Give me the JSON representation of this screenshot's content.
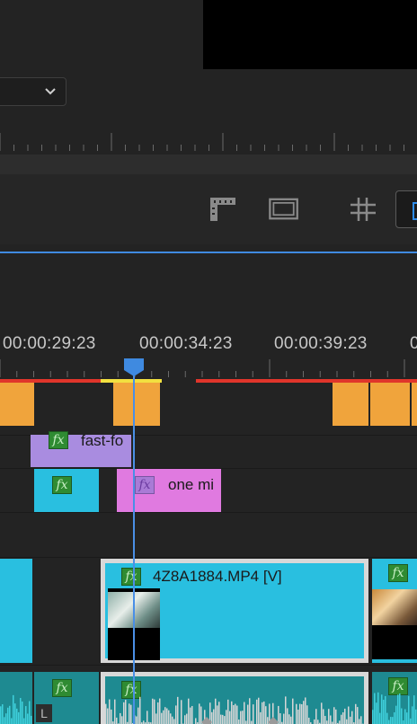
{
  "timeline": {
    "timecodes": [
      "00:00:29:23",
      "00:00:34:23",
      "00:00:39:23",
      "0"
    ]
  },
  "clips": {
    "graphic_upper": {
      "name": "fast-fo",
      "fx": "fx"
    },
    "graphic_lower_teal": {
      "fx": "fx"
    },
    "graphic_pink": {
      "name": "one mi",
      "fx": "fx"
    },
    "video_main": {
      "name": "4Z8A1884.MP4 [V]",
      "fx": "fx"
    },
    "video_right": {
      "fx": "fx"
    },
    "audio_left_small": {
      "fx": "fx",
      "channel": "L"
    },
    "audio_main": {
      "fx": "fx"
    },
    "audio_right": {
      "fx": "fx"
    }
  },
  "icons": [
    "dropdown-chevron-icon",
    "marker-tool-icon",
    "safe-margins-icon",
    "grid-icon",
    "comparison-view-icon",
    "playhead-icon"
  ],
  "colors": {
    "clip_cyan": "#29bfe0",
    "clip_lavender": "#a98ce0",
    "clip_pink": "#e07ae0",
    "clip_orange": "#f0a43c",
    "audio_teal": "#1e8a91",
    "render_red": "#e0352b",
    "render_yellow": "#f2e040",
    "playhead_blue": "#3f8ae0"
  }
}
